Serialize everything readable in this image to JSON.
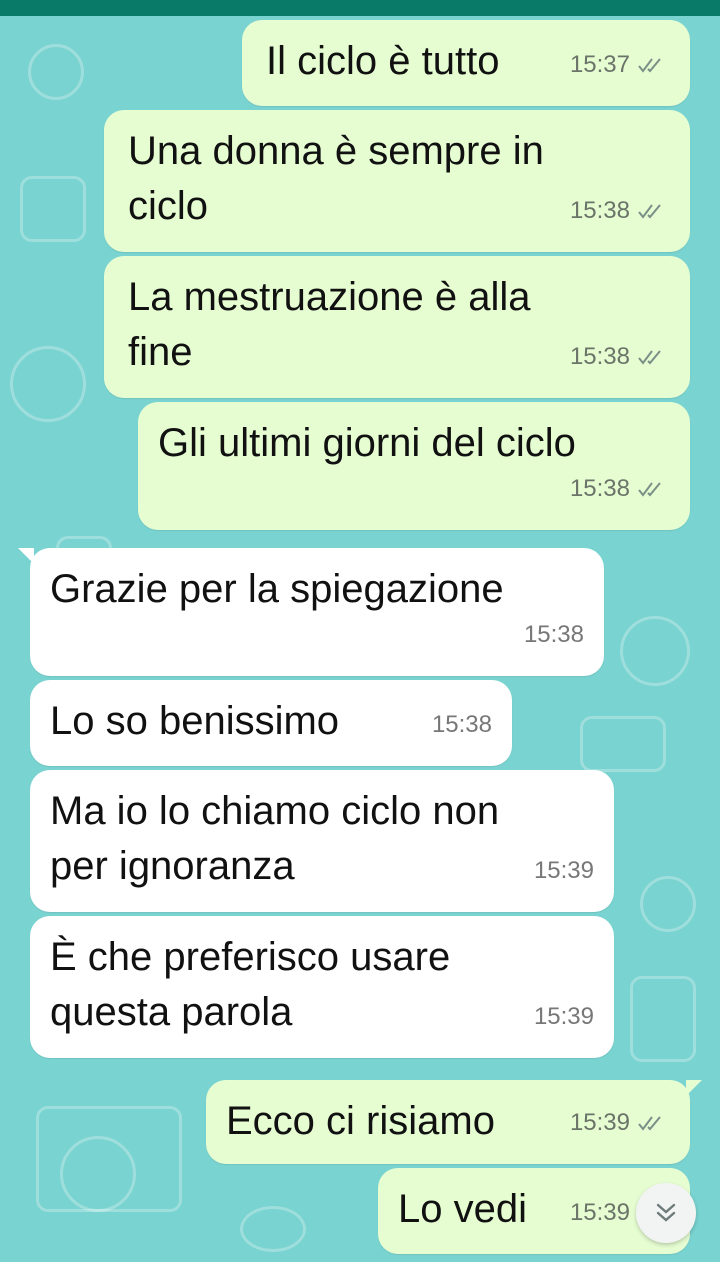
{
  "colors": {
    "header": "#0a7a68",
    "wallpaper": "#79d3d0",
    "outgoing_bubble": "#e6fdd2",
    "incoming_bubble": "#ffffff",
    "read_ticks": "#7a8f86"
  },
  "messages": [
    {
      "direction": "out",
      "text": "Il ciclo è tutto",
      "time": "15:37",
      "status": "read"
    },
    {
      "direction": "out",
      "text_lines": [
        "Una donna è sempre in",
        "ciclo"
      ],
      "time": "15:38",
      "status": "read"
    },
    {
      "direction": "out",
      "text_lines": [
        "La mestruazione è alla",
        "fine"
      ],
      "time": "15:38",
      "status": "read"
    },
    {
      "direction": "out",
      "text": "Gli ultimi giorni del ciclo",
      "time": "15:38",
      "status": "read"
    },
    {
      "direction": "in",
      "text": "Grazie per la spiegazione",
      "time": "15:38"
    },
    {
      "direction": "in",
      "text": "Lo so benissimo",
      "time": "15:38"
    },
    {
      "direction": "in",
      "text_lines": [
        "Ma io lo chiamo ciclo non",
        "per ignoranza"
      ],
      "time": "15:39"
    },
    {
      "direction": "in",
      "text_lines": [
        "È che preferisco usare",
        "questa parola"
      ],
      "time": "15:39"
    },
    {
      "direction": "out",
      "text": "Ecco ci risiamo",
      "time": "15:39",
      "status": "read"
    },
    {
      "direction": "out",
      "text": "Lo vedi",
      "time": "15:39",
      "status": "read"
    }
  ],
  "scroll_button": {
    "icon": "double-chevron-down-icon"
  }
}
